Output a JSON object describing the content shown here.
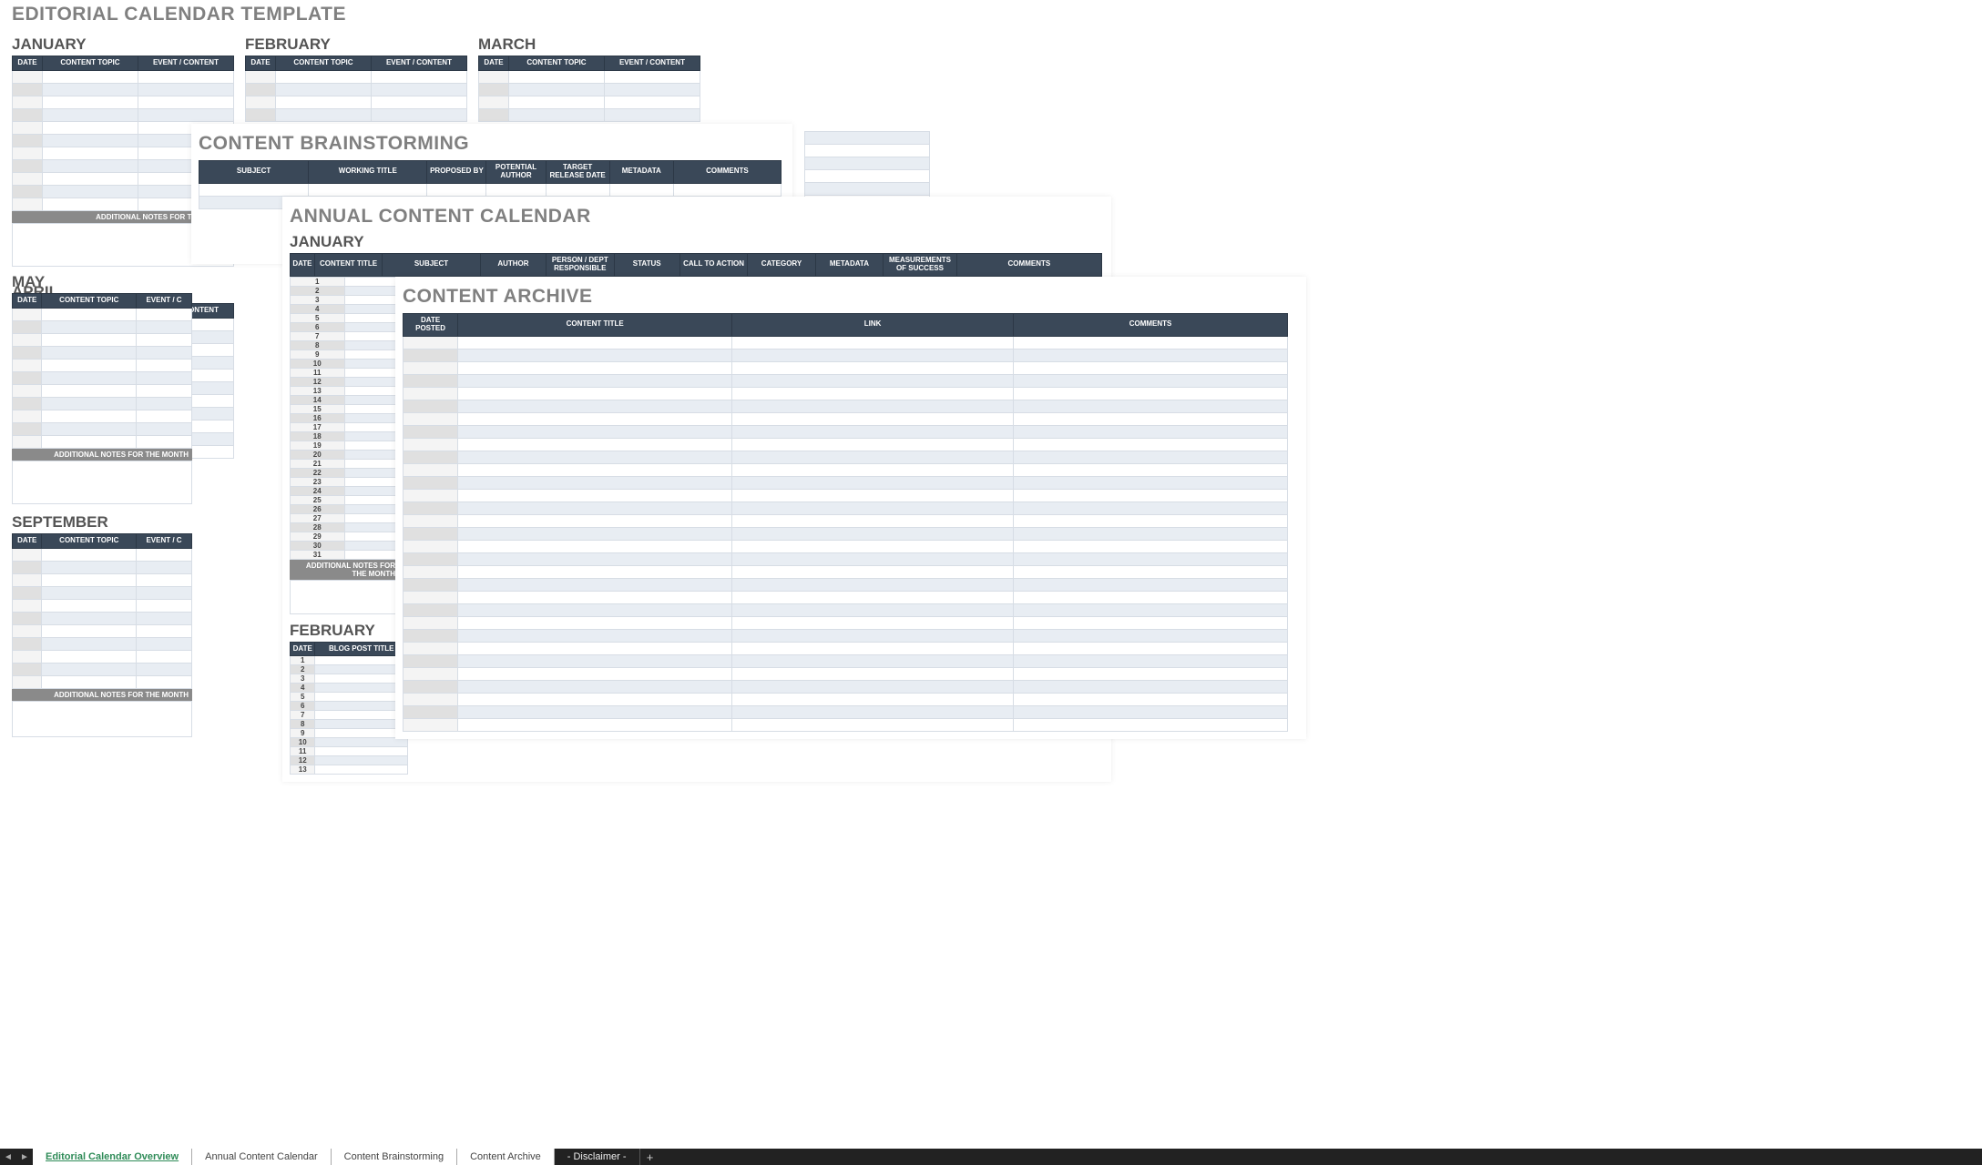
{
  "editorial": {
    "title": "EDITORIAL CALENDAR TEMPLATE",
    "months_row1": [
      "JANUARY",
      "FEBRUARY",
      "MARCH",
      "APRIL"
    ],
    "months_row2": [
      "MAY"
    ],
    "months_row3": [
      "SEPTEMBER"
    ],
    "columns": {
      "date": "DATE",
      "topic": "CONTENT TOPIC",
      "event": "EVENT / CONTENT"
    },
    "notes_label": "ADDITIONAL NOTES FOR THE MONTH"
  },
  "brainstorm": {
    "title": "CONTENT BRAINSTORMING",
    "columns": [
      "SUBJECT",
      "WORKING TITLE",
      "PROPOSED BY",
      "POTENTIAL AUTHOR",
      "TARGET RELEASE DATE",
      "METADATA",
      "COMMENTS"
    ]
  },
  "annual": {
    "title": "ANNUAL CONTENT CALENDAR",
    "month1": "JANUARY",
    "month2": "FEBRUARY",
    "columns": [
      "DATE",
      "CONTENT TITLE",
      "SUBJECT",
      "AUTHOR",
      "PERSON / DEPT RESPONSIBLE",
      "STATUS",
      "CALL TO ACTION",
      "CATEGORY",
      "METADATA",
      "MEASUREMENTS OF SUCCESS",
      "COMMENTS"
    ],
    "feb_columns": [
      "DATE",
      "BLOG POST TITLE"
    ],
    "days": [
      "1",
      "2",
      "3",
      "4",
      "5",
      "6",
      "7",
      "8",
      "9",
      "10",
      "11",
      "12",
      "13",
      "14",
      "15",
      "16",
      "17",
      "18",
      "19",
      "20",
      "21",
      "22",
      "23",
      "24",
      "25",
      "26",
      "27",
      "28",
      "29",
      "30",
      "31"
    ],
    "feb_days": [
      "1",
      "2",
      "3",
      "4",
      "5",
      "6",
      "7",
      "8",
      "9",
      "10",
      "11",
      "12",
      "13"
    ],
    "notes_label": "ADDITIONAL NOTES FOR THE MONTH"
  },
  "archive": {
    "title": "CONTENT ARCHIVE",
    "columns": [
      "DATE POSTED",
      "CONTENT TITLE",
      "LINK",
      "COMMENTS"
    ]
  },
  "tabs": {
    "t1": "Editorial Calendar Overview",
    "t2": "Annual Content Calendar",
    "t3": "Content Brainstorming",
    "t4": "Content Archive",
    "t5": "- Disclaimer -"
  }
}
